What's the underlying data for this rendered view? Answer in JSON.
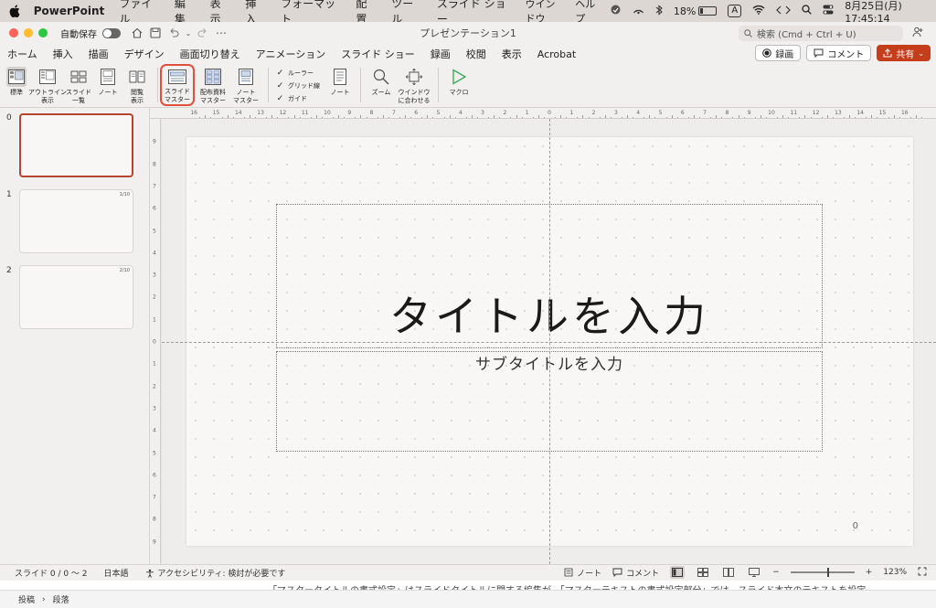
{
  "menubar": {
    "app_name": "PowerPoint",
    "items": [
      "ファイル",
      "編集",
      "表示",
      "挿入",
      "フォーマット",
      "配置",
      "ツール",
      "スライド ショー",
      "ウインドウ",
      "ヘルプ"
    ],
    "battery": "18%",
    "input_mode": "A",
    "datetime": "8月25日(月)  17:45:14"
  },
  "titlebar": {
    "autosave_label": "自動保存",
    "doc_title": "プレゼンテーション1",
    "search_placeholder": "検索 (Cmd + Ctrl + U)"
  },
  "tabs": {
    "items": [
      "ホーム",
      "挿入",
      "描画",
      "デザイン",
      "画面切り替え",
      "アニメーション",
      "スライド ショー",
      "録画",
      "校閲",
      "表示",
      "Acrobat"
    ],
    "active_index": 9,
    "record_label": "録画",
    "comment_label": "コメント",
    "share_label": "共有"
  },
  "ribbon": {
    "normal": "標準",
    "outline": "アウトライン\n表示",
    "sorter": "スライド\n一覧",
    "notes": "ノート",
    "reading": "閲覧\n表示",
    "slide_master": "スライド\nマスター",
    "handout_master": "配布資料\nマスター",
    "notes_master": "ノート\nマスター",
    "ruler": "ルーラー",
    "gridlines": "グリッド線",
    "guides": "ガイド",
    "notes2": "ノート",
    "zoom": "ズーム",
    "fit_window": "ウインドウ\nに合わせる",
    "macro": "マクロ"
  },
  "ruler": {
    "h_labels": [
      "16",
      "15",
      "14",
      "13",
      "12",
      "11",
      "10",
      "9",
      "8",
      "7",
      "6",
      "5",
      "4",
      "3",
      "2",
      "1",
      "0",
      "1",
      "2",
      "3",
      "4",
      "5",
      "6",
      "7",
      "8",
      "9",
      "10",
      "11",
      "12",
      "13",
      "14",
      "15",
      "16"
    ],
    "v_labels": [
      "9",
      "8",
      "7",
      "6",
      "5",
      "4",
      "3",
      "2",
      "1",
      "0",
      "1",
      "2",
      "3",
      "4",
      "5",
      "6",
      "7",
      "8",
      "9"
    ]
  },
  "thumbnails": [
    {
      "num": "0",
      "badge": ""
    },
    {
      "num": "1",
      "badge": "1/10"
    },
    {
      "num": "2",
      "badge": "2/10"
    }
  ],
  "slide": {
    "title_placeholder": "タイトルを入力",
    "subtitle_placeholder": "サブタイトルを入力",
    "slide_number": "0"
  },
  "statusbar": {
    "slide_info": "スライド 0 / 0 〜 2",
    "language": "日本語",
    "accessibility": "アクセシビリティ: 検討が必要です",
    "notes": "ノート",
    "comments": "コメント",
    "zoom": "123%"
  },
  "behind": {
    "text": "「マスタータイトルの書式設定」はスライドタイトルに関する編集が、「マスターテキストの書式設定部分」では、スライド本文のテキストを設定",
    "breadcrumb_1": "投稿",
    "breadcrumb_2": "段落"
  }
}
